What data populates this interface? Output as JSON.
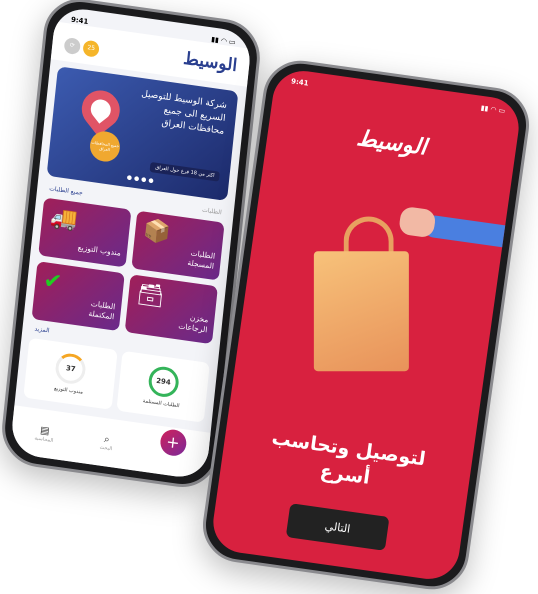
{
  "left_phone": {
    "time": "9:41",
    "logo": "الوسيط",
    "badge_count": "25",
    "banner": {
      "title": "شركة الوسيط للتوصيل السريع الى جميع محافظات العراق",
      "seal": "جميع المحافظات العراق",
      "chip": "اكثر من 18 فرع حول العراق"
    },
    "orders_section": {
      "title": "الطلبات",
      "link": "جميع الطلبات"
    },
    "cards": [
      {
        "label": "الطلبات المسجلة",
        "icon": "box-icon"
      },
      {
        "label": "مندوب التوزيع",
        "icon": "truck-icon"
      },
      {
        "label": "مخزن الرجاعات",
        "icon": "returns-box-icon"
      },
      {
        "label": "الطلبات المكتملة",
        "icon": "check-icon"
      }
    ],
    "more_link": "المزيد",
    "stats": [
      {
        "label": "الطلبات المستلمة",
        "value": "294",
        "color": "#34b45a"
      },
      {
        "label": "مندوب التوزيع",
        "value": "37",
        "color": "#f5a623"
      }
    ],
    "nav": [
      {
        "label": "المحاسبة",
        "icon": "receipt-icon"
      },
      {
        "label": "البحث",
        "icon": "search-icon"
      }
    ],
    "fab": "+"
  },
  "right_phone": {
    "time": "9:41",
    "logo": "الوسيط",
    "slogan_line1": "لتوصيل وتحاسب",
    "slogan_line2": "أسرع",
    "next_button": "التالي",
    "bg_color": "#d8213f"
  }
}
